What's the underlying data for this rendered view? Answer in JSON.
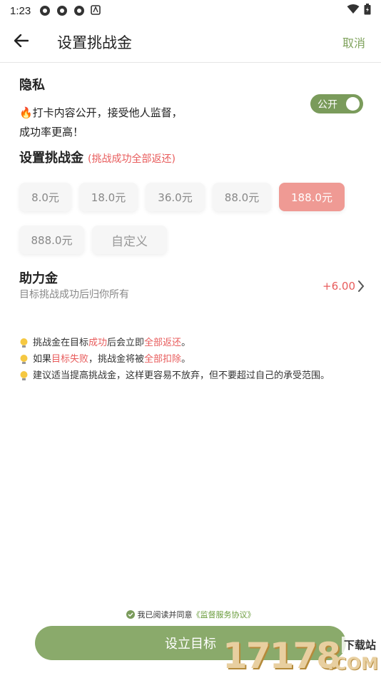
{
  "status": {
    "time": "1:23",
    "icons": [
      "app-icon",
      "app-icon",
      "app-icon",
      "text-icon"
    ],
    "right_icons": [
      "wifi-icon",
      "battery-icon"
    ]
  },
  "header": {
    "title": "设置挑战金",
    "cancel_label": "取消"
  },
  "privacy": {
    "title": "隐私",
    "desc_line1": "🔥打卡内容公开，接受他人监督，",
    "desc_line2": "成功率更高！",
    "toggle_label": "公开",
    "toggle_on": true
  },
  "stake": {
    "title": "设置挑战金",
    "subtitle": "(挑战成功全部返还)",
    "options": [
      "8.0元",
      "18.0元",
      "36.0元",
      "88.0元",
      "188.0元",
      "888.0元"
    ],
    "selected": "188.0元",
    "custom_label": "自定义"
  },
  "assist": {
    "title": "助力金",
    "subtitle": "目标挑战成功后归你所有",
    "value": "+6.00"
  },
  "tips": {
    "t1_a": "挑战金在目标",
    "t1_b": "成功",
    "t1_c": "后会立即",
    "t1_d": "全部返还",
    "t1_e": "。",
    "t2_a": "如果",
    "t2_b": "目标失败",
    "t2_c": "，挑战金将被",
    "t2_d": "全部扣除",
    "t2_e": "。",
    "t3": "建议适当提高挑战金，这样更容易不放弃，但不要超过自己的承受范围。"
  },
  "footer": {
    "agree_text": "我已阅读并同意",
    "agree_link": "《监督服务协议》",
    "submit_label": "设立目标"
  },
  "watermark": {
    "number": "17178",
    "cn": "下载站",
    "com": ".COM"
  },
  "colors": {
    "accent_green": "#7a9b5b",
    "button_green": "#8aaa6b",
    "red": "#e85c5c",
    "chip_selected": "#ef9a94"
  }
}
